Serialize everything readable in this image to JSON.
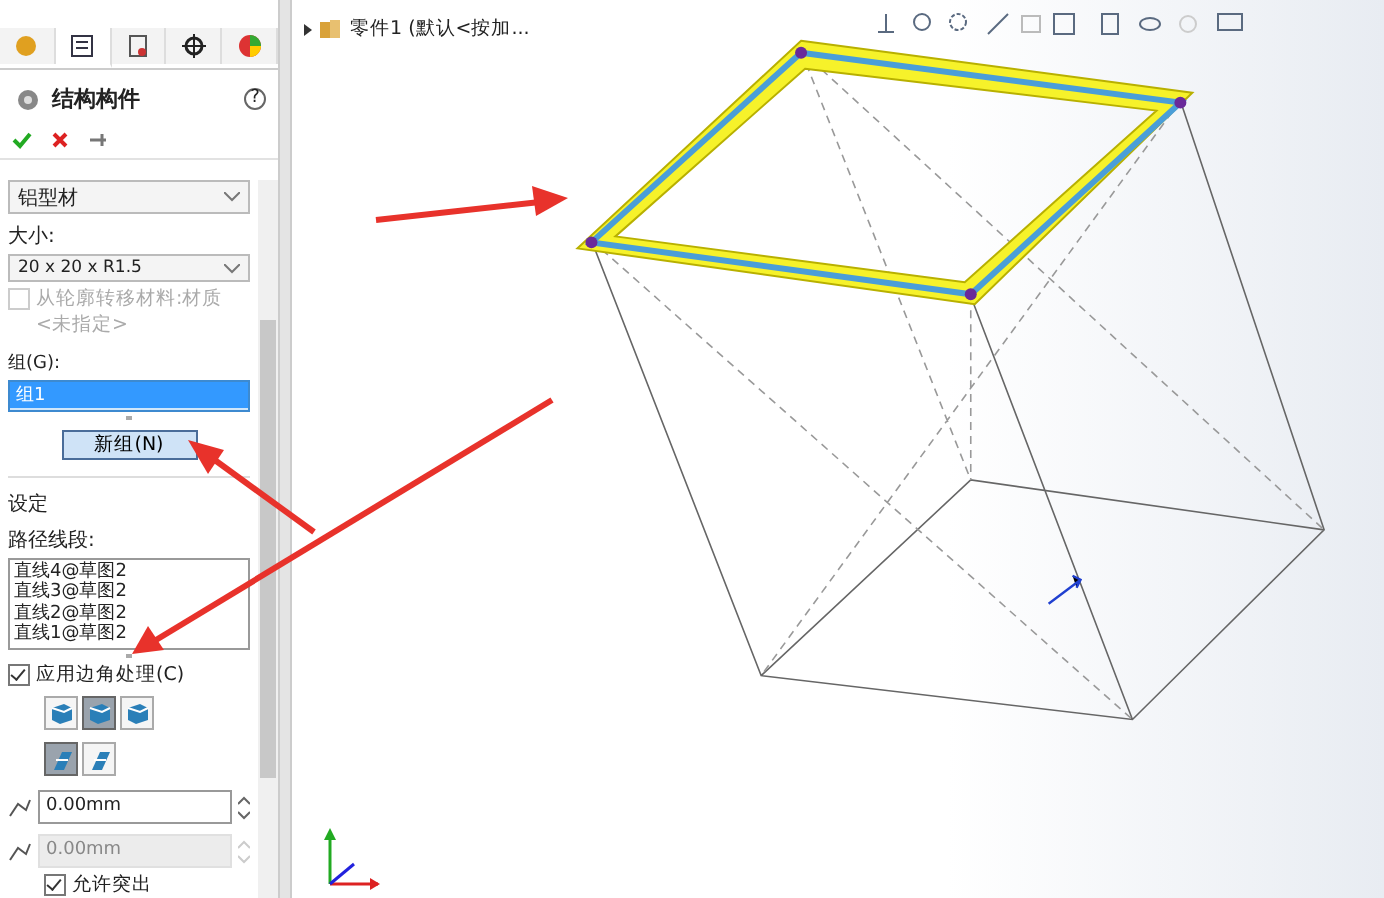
{
  "panel_tabs": [
    {
      "selected": false
    },
    {
      "selected": true
    },
    {
      "selected": false
    },
    {
      "selected": false
    },
    {
      "selected": false
    }
  ],
  "panel": {
    "title": "结构构件",
    "help": "?",
    "standard": {
      "value": "铝型材"
    },
    "size": {
      "label": "大小:",
      "value": "20 x 20 x R1.5"
    },
    "transfer": {
      "label": "从轮廓转移材料:材质",
      "sublabel": "<未指定>",
      "checked": false,
      "disabled": true
    },
    "groups": {
      "label": "组(G):",
      "items": [
        {
          "label": "组1",
          "selected": true
        }
      ]
    },
    "new_group_button": "新组(N)",
    "settings_label": "设定",
    "path_label": "路径线段:",
    "segments": [
      "直线4@草图2",
      "直线3@草图2",
      "直线2@草图2",
      "直线1@草图2"
    ],
    "corner": {
      "label": "应用边角处理(C)",
      "checked": true
    },
    "corner_types": [
      {
        "selected": false
      },
      {
        "selected": true
      },
      {
        "selected": false
      }
    ],
    "trim_types": [
      {
        "selected": true
      },
      {
        "selected": false
      }
    ],
    "gaps": [
      {
        "value": "0.00mm",
        "disabled": false
      },
      {
        "value": "0.00mm",
        "disabled": true
      }
    ],
    "allow_extend": {
      "label": "允许突出",
      "checked": true
    }
  },
  "tree": {
    "item": "零件1  (默认<按加..."
  }
}
